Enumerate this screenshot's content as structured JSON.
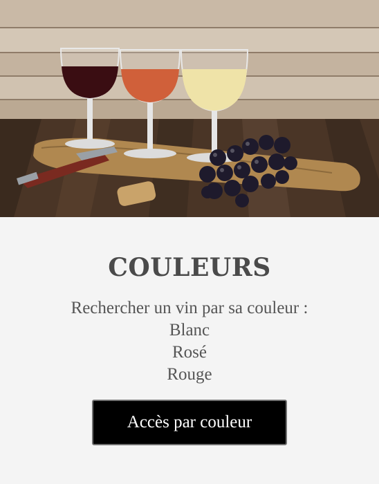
{
  "hero": {
    "image": "wine-glasses-grapes-corkscrew-photo"
  },
  "section": {
    "title": "COULEURS",
    "intro": "Rechercher un vin par sa couleur :",
    "colors": [
      "Blanc",
      "Rosé",
      "Rouge"
    ]
  },
  "button": {
    "label": "Accès par couleur"
  },
  "colors": {
    "background": "#f4f4f4",
    "title": "#4a4a4a",
    "text": "#555555",
    "button_bg": "#000000",
    "button_text": "#ffffff"
  }
}
